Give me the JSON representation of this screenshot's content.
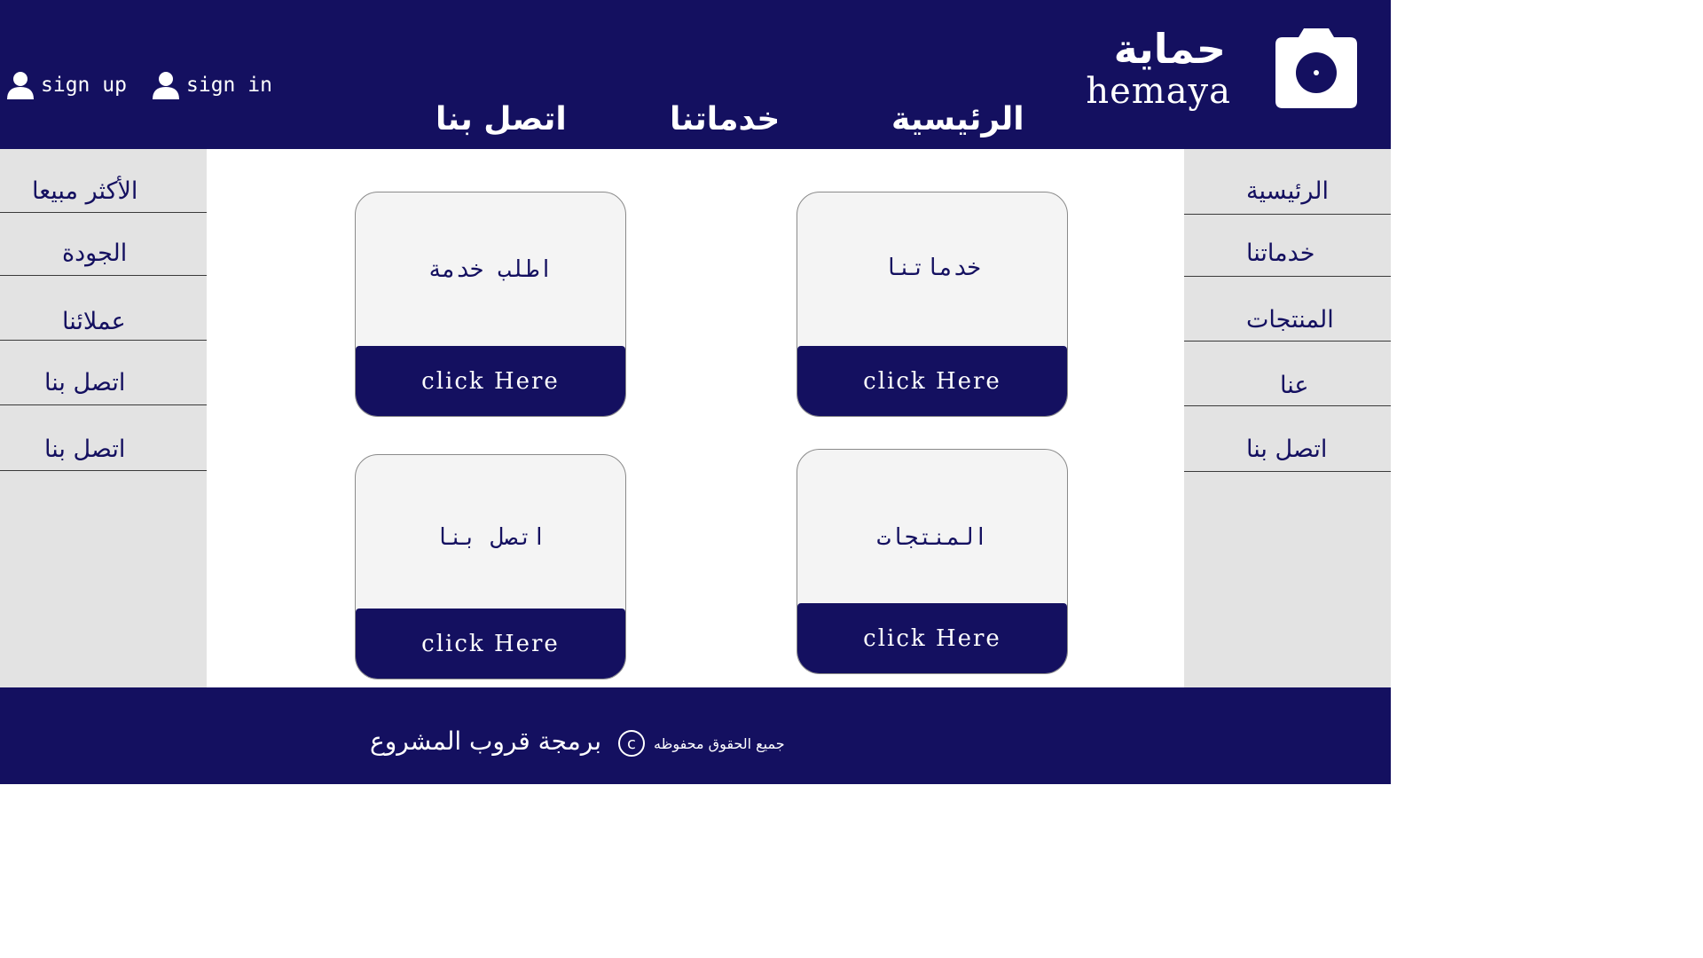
{
  "header": {
    "sign_up": "sign up",
    "sign_in": "sign in",
    "logo_ar": "حماية",
    "logo_en": "hemaya",
    "nav": {
      "home": "الرئيسية",
      "services": "خدماتنا",
      "contact": "اتصل بنا"
    }
  },
  "left_sidebar": {
    "items": [
      "الأكثر مبيعا",
      "الجودة",
      "عملائنا",
      "اتصل بنا",
      "اتصل بنا"
    ]
  },
  "right_sidebar": {
    "items": [
      "الرئيسية",
      "خدماتنا",
      "المنتجات",
      "عنا",
      "اتصل بنا"
    ]
  },
  "cards": [
    {
      "title": "اطلب خدمة",
      "button": "click Here"
    },
    {
      "title": "خدماتنا",
      "button": "click Here"
    },
    {
      "title": "اتصل بنا",
      "button": "click Here"
    },
    {
      "title": "المنتجات",
      "button": "click Here"
    }
  ],
  "footer": {
    "team": "برمجة قروب المشروع",
    "copyright_symbol": "c",
    "rights": "جميع الحقوق محفوظه"
  },
  "colors": {
    "primary": "#141060",
    "sidebar": "#e3e3e3",
    "card_bg": "#f4f4f4"
  },
  "icons": [
    "user-icon",
    "camera-icon",
    "copyright-icon"
  ]
}
